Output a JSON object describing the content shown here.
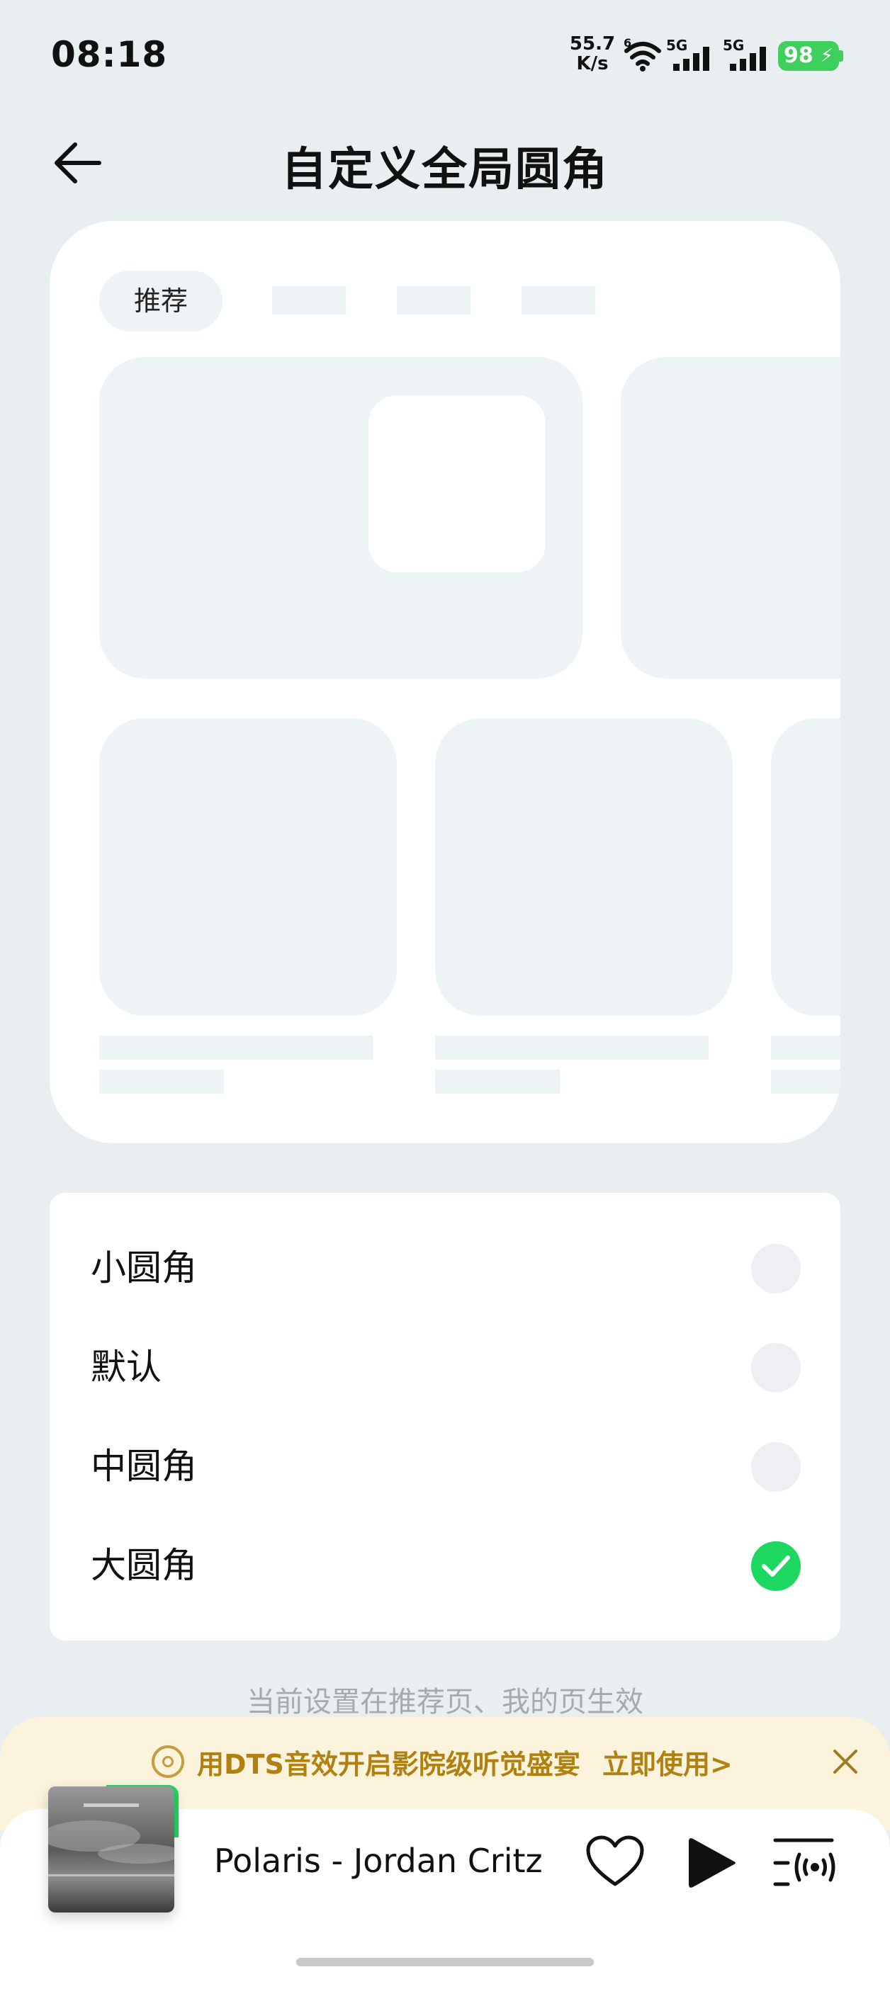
{
  "status_bar": {
    "time": "08:18",
    "net_speed_value": "55.7",
    "net_speed_unit": "K/s",
    "wifi_badge": "6",
    "sim1_label": "5G",
    "sim2_label": "5G",
    "battery": "98"
  },
  "header": {
    "back_icon": "arrow-left-icon",
    "title": "自定义全局圆角"
  },
  "preview": {
    "tab_label": "推荐"
  },
  "options": [
    {
      "label": "小圆角",
      "selected": false
    },
    {
      "label": "默认",
      "selected": false
    },
    {
      "label": "中圆角",
      "selected": false
    },
    {
      "label": "大圆角",
      "selected": true
    }
  ],
  "hint": "当前设置在推荐页、我的页生效",
  "dts_banner": {
    "text": "用DTS音效开启影院级听觉盛宴",
    "cta": "立即使用>",
    "close_icon": "close-icon"
  },
  "player": {
    "song": "Polaris - Jordan Critz",
    "accent_color": "#1ed760",
    "icons": [
      "heart-icon",
      "play-icon",
      "playlist-icon"
    ]
  }
}
